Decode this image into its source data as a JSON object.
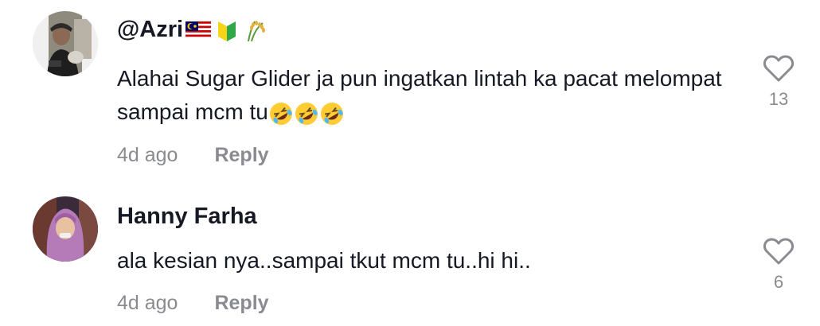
{
  "comments": [
    {
      "username": "@Azri",
      "badges": [
        "malaysia-flag-icon",
        "beginner-symbol-icon",
        "rice-sheaf-icon"
      ],
      "text": "Alahai Sugar Glider ja pun ingatkan lintah ka pacat melompat sampai mcm tu",
      "emojis": [
        "rolling-laughing-icon",
        "rolling-laughing-icon",
        "rolling-laughing-icon"
      ],
      "time": "4d ago",
      "reply_label": "Reply",
      "likes": "13"
    },
    {
      "username": "Hanny Farha",
      "text": "ala kesian nya..sampai tkut mcm tu..hi hi..",
      "time": "4d ago",
      "reply_label": "Reply",
      "likes": "6"
    }
  ],
  "colors": {
    "text": "#161823",
    "muted": "#8a8b91",
    "heart_outline": "#8a8b91"
  }
}
